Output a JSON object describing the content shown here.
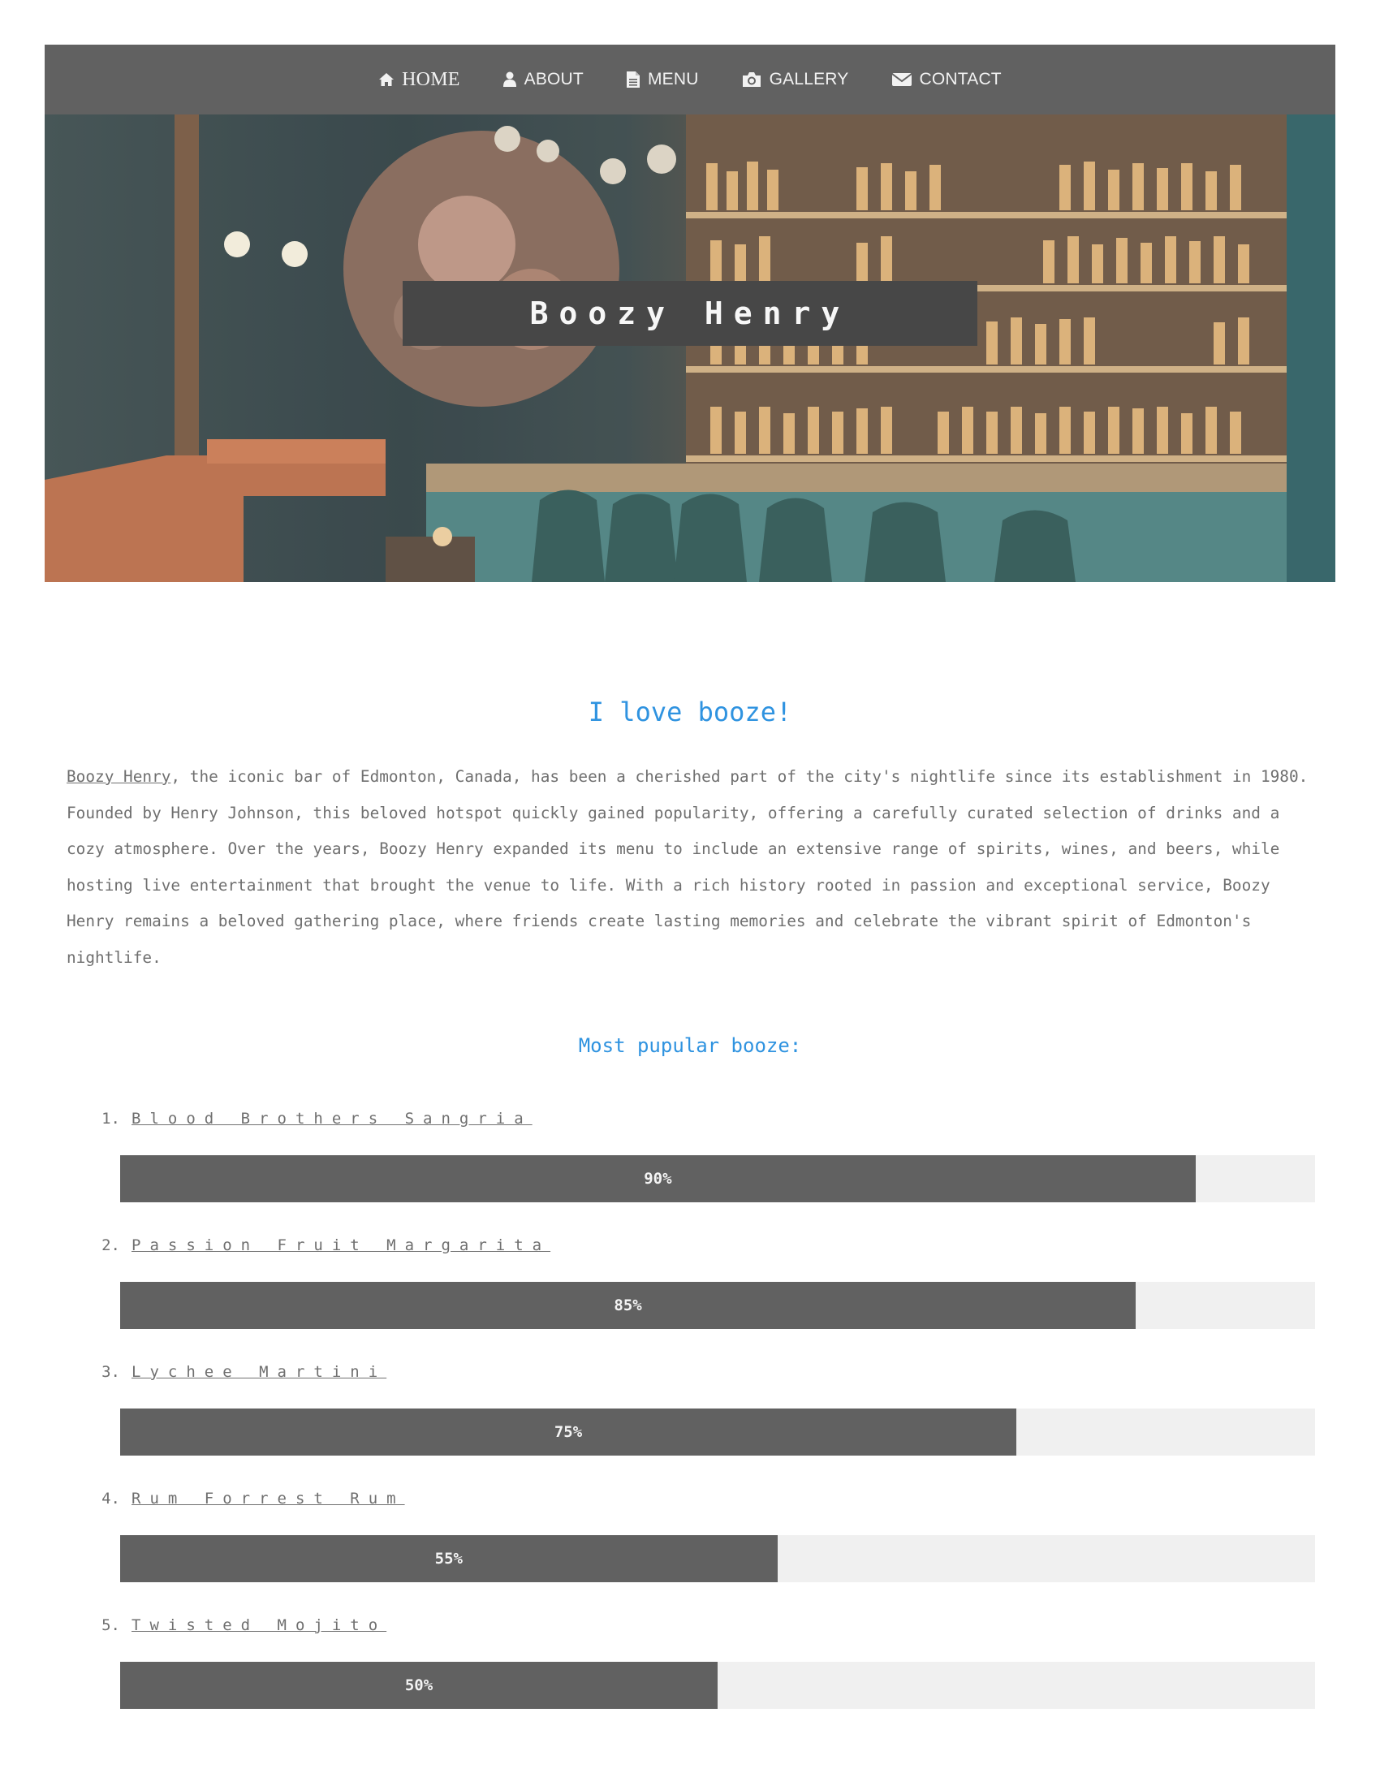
{
  "nav": {
    "items": [
      {
        "label": "HOME",
        "icon": "home-icon"
      },
      {
        "label": "ABOUT",
        "icon": "user-icon"
      },
      {
        "label": "MENU",
        "icon": "document-icon"
      },
      {
        "label": "GALLERY",
        "icon": "camera-icon"
      },
      {
        "label": "CONTACT",
        "icon": "envelope-icon"
      }
    ]
  },
  "hero": {
    "title": "Boozy Henry"
  },
  "main": {
    "heading": "I love booze!",
    "intro_link": "Boozy Henry",
    "intro_text": ", the iconic bar of Edmonton, Canada, has been a cherished part of the city's nightlife since its establishment in 1980. Founded by Henry Johnson, this beloved hotspot quickly gained popularity, offering a carefully curated selection of drinks and a cozy atmosphere. Over the years, Boozy Henry expanded its menu to include an extensive range of spirits, wines, and beers, while hosting live entertainment that brought the venue to life. With a rich history rooted in passion and exceptional service, Boozy Henry remains a beloved gathering place, where friends create lasting memories and celebrate the vibrant spirit of Edmonton's nightlife.",
    "list_heading": "Most pupular booze:"
  },
  "booze": [
    {
      "num": "1.",
      "name": "Blood Brothers Sangria",
      "percent": 90,
      "label": "90%"
    },
    {
      "num": "2.",
      "name": "Passion Fruit Margarita",
      "percent": 85,
      "label": "85%"
    },
    {
      "num": "3.",
      "name": "Lychee Martini",
      "percent": 75,
      "label": "75%"
    },
    {
      "num": "4.",
      "name": "Rum Forrest Rum",
      "percent": 55,
      "label": "55%"
    },
    {
      "num": "5.",
      "name": "Twisted Mojito",
      "percent": 50,
      "label": "50%"
    }
  ]
}
